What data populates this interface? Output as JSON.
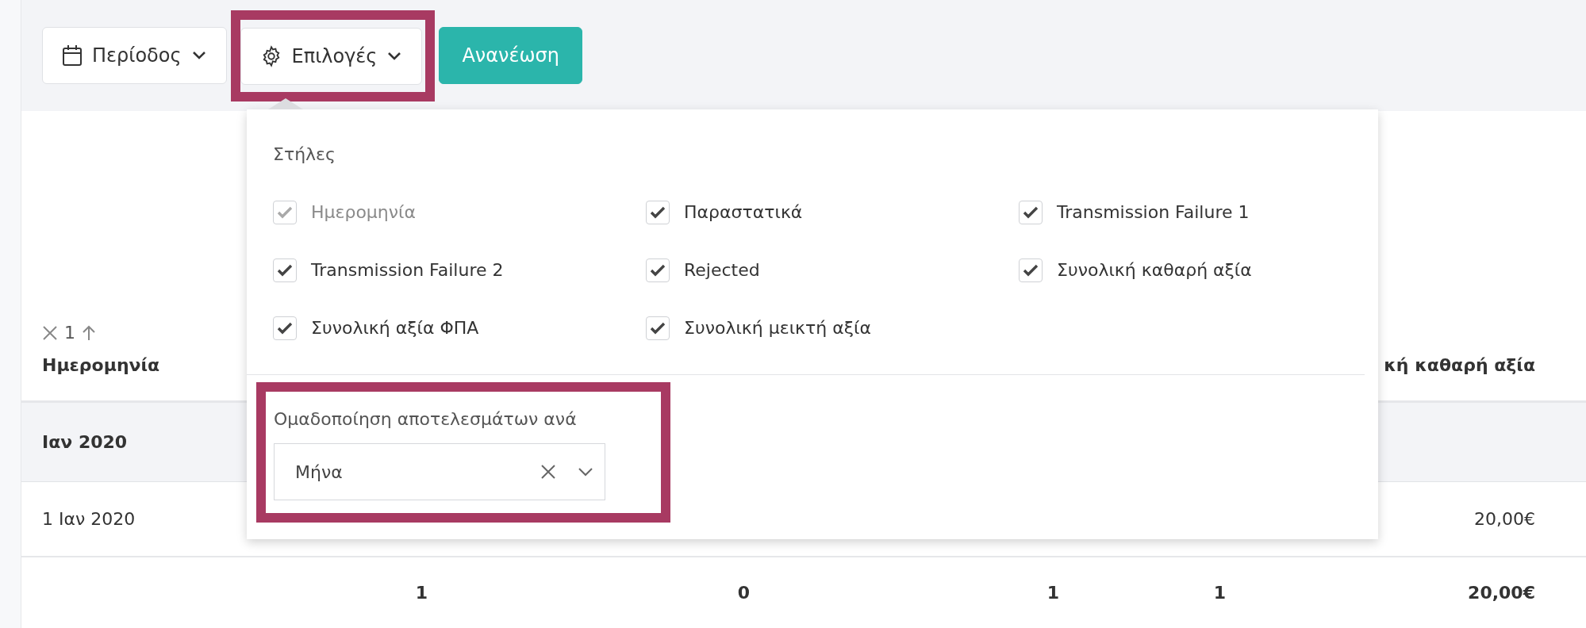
{
  "toolbar": {
    "buttons": [
      {
        "kind": "dropdown",
        "label": "Περίοδος",
        "highlighted": false
      },
      {
        "kind": "dropdown",
        "label": "Επιλογές",
        "highlighted": true
      },
      {
        "kind": "primary",
        "label": "Ανανέωση",
        "highlighted": false
      }
    ]
  },
  "options": {
    "columns_title": "Στήλες",
    "columns": [
      {
        "label": "Ημερομηνία",
        "checked": true,
        "disabled": true
      },
      {
        "label": "Παραστατικά",
        "checked": true,
        "disabled": false
      },
      {
        "label": "Transmission Failure 1",
        "checked": true,
        "disabled": false
      },
      {
        "label": "Transmission Failure 2",
        "checked": true,
        "disabled": false
      },
      {
        "label": "Rejected",
        "checked": true,
        "disabled": false
      },
      {
        "label": "Συνολική καθαρή αξία",
        "checked": true,
        "disabled": false
      },
      {
        "label": "Συνολική αξία ΦΠΑ",
        "checked": true,
        "disabled": false
      },
      {
        "label": "Συνολική μεικτή αξία",
        "checked": true,
        "disabled": false
      }
    ],
    "group_by": {
      "label": "Ομαδοποίηση αποτελεσμάτων ανά",
      "value": "Μήνα",
      "highlighted": true
    }
  },
  "table": {
    "header": {
      "sort_order": "1",
      "first_column": "Ημερομηνία",
      "last_column": "κή καθαρή αξία"
    },
    "group_row": {
      "label": "Ιαν 2020"
    },
    "rows": [
      {
        "date": "1 Ιαν 2020",
        "amount": "20,00€"
      }
    ],
    "totals": [
      "1",
      "0",
      "1",
      "1",
      "20,00€"
    ]
  }
}
